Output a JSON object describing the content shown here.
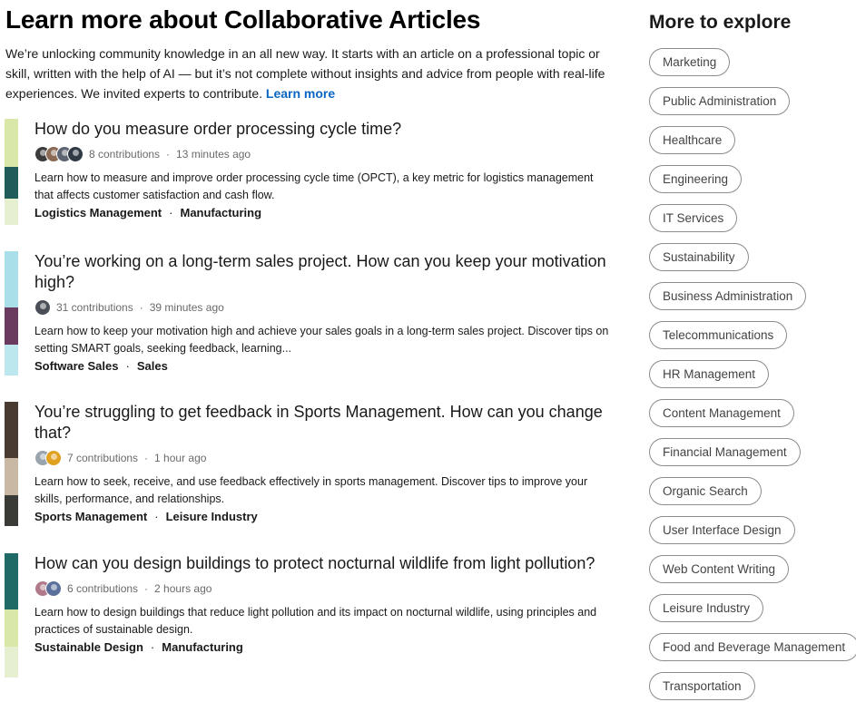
{
  "page": {
    "title": "Learn more about Collaborative Articles",
    "intro": "We’re unlocking community knowledge in an all new way. It starts with an article on a professional topic or skill, written with the help of AI — but it’s not complete without insights and advice from people with real-life experiences. We invited experts to contribute.",
    "learn_more": "Learn more"
  },
  "articles": [
    {
      "title": "How do you measure order processing cycle time?",
      "contributions": "8 contributions",
      "time": "13 minutes ago",
      "description": "Learn how to measure and improve order processing cycle time (OPCT), a key metric for logistics management that affects customer satisfaction and cash flow.",
      "tags": [
        "Logistics Management",
        "Manufacturing"
      ],
      "avatars": [
        "#3b3b3b",
        "#8a6a55",
        "#5b6470",
        "#2f3a45"
      ],
      "thumb_colors": [
        "#d9e8a8",
        "#1f5c5a",
        "#e6efd0"
      ]
    },
    {
      "title": "You’re working on a long-term sales project. How can you keep your motivation high?",
      "contributions": "31 contributions",
      "time": "39 minutes ago",
      "description": "Learn how to keep your motivation high and achieve your sales goals in a long-term sales project. Discover tips on setting SMART goals, seeking feedback, learning...",
      "tags": [
        "Software Sales",
        "Sales"
      ],
      "avatars": [
        "#4a4f57"
      ],
      "thumb_colors": [
        "#a8dfe8",
        "#6a3b5e",
        "#bde7ee"
      ]
    },
    {
      "title": "You’re struggling to get feedback in Sports Management. How can you change that?",
      "contributions": "7 contributions",
      "time": "1 hour ago",
      "description": "Learn how to seek, receive, and use feedback effectively in sports management. Discover tips to improve your skills, performance, and relationships.",
      "tags": [
        "Sports Management",
        "Leisure Industry"
      ],
      "avatars": [
        "#9aa4ae",
        "#e0a020"
      ],
      "thumb_colors": [
        "#4a3b32",
        "#c9b8a3",
        "#3a3a36"
      ]
    },
    {
      "title": "How can you design buildings to protect nocturnal wildlife from light pollution?",
      "contributions": "6 contributions",
      "time": "2 hours ago",
      "description": "Learn how to design buildings that reduce light pollution and its impact on nocturnal wildlife, using principles and practices of sustainable design.",
      "tags": [
        "Sustainable Design",
        "Manufacturing"
      ],
      "avatars": [
        "#b07a8a",
        "#5a6f9a"
      ],
      "thumb_colors": [
        "#1f6a66",
        "#d9e8a8",
        "#e6efd0"
      ]
    }
  ],
  "sidebar": {
    "title": "More to explore",
    "topics": [
      "Marketing",
      "Public Administration",
      "Healthcare",
      "Engineering",
      "IT Services",
      "Sustainability",
      "Business Administration",
      "Telecommunications",
      "HR Management",
      "Content Management",
      "Financial Management",
      "Organic Search",
      "User Interface Design",
      "Web Content Writing",
      "Leisure Industry",
      "Food and Beverage Management",
      "Transportation"
    ]
  },
  "colors": {
    "link": "#0a66c2",
    "text": "#1a1a1a",
    "muted": "#666666",
    "pill_border": "#8c8c8c"
  }
}
